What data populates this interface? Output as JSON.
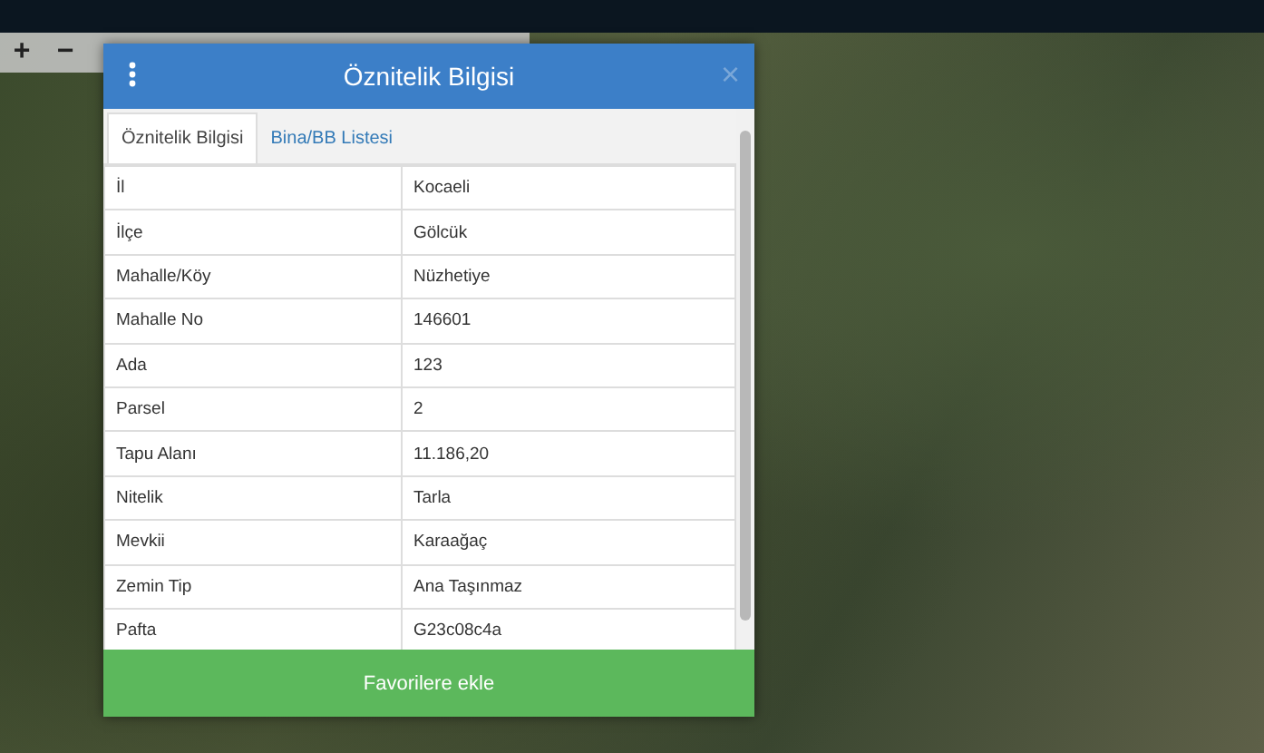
{
  "map_controls": {
    "zoom_in": "+",
    "zoom_out": "−"
  },
  "dialog": {
    "title": "Öznitelik Bilgisi",
    "close": "×",
    "tabs": [
      {
        "label": "Öznitelik Bilgisi",
        "selected": true
      },
      {
        "label": "Bina/BB Listesi",
        "selected": false
      }
    ],
    "rows": [
      {
        "label": "İl",
        "value": "Kocaeli"
      },
      {
        "label": "İlçe",
        "value": "Gölcük"
      },
      {
        "label": "Mahalle/Köy",
        "value": "Nüzhetiye"
      },
      {
        "label": "Mahalle No",
        "value": "146601"
      },
      {
        "label": "Ada",
        "value": "123"
      },
      {
        "label": "Parsel",
        "value": "2"
      },
      {
        "label": "Tapu Alanı",
        "value": "11.186,20"
      },
      {
        "label": "Nitelik",
        "value": "Tarla"
      },
      {
        "label": "Mevkii",
        "value": "Karaağaç"
      },
      {
        "label": "Zemin Tip",
        "value": "Ana Taşınmaz"
      },
      {
        "label": "Pafta",
        "value": "G23c08c4a"
      }
    ],
    "button": "Favorilere ekle"
  }
}
